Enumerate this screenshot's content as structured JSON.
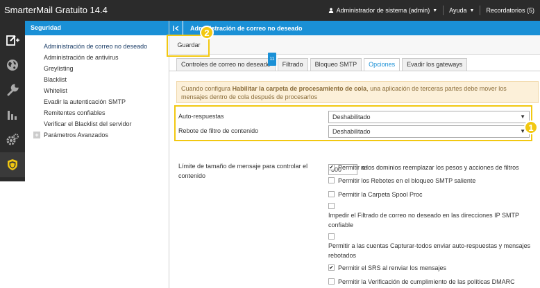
{
  "app": {
    "title": "SmarterMail Gratuito 14.4",
    "user_menu": "Administrador de sistema (admin)",
    "help_menu": "Ayuda",
    "reminders": "Recordatorios (5)"
  },
  "sidebar": {
    "header": "Seguridad",
    "items": [
      {
        "label": "Administración de correo no deseado",
        "selected": true
      },
      {
        "label": "Administración de antivirus"
      },
      {
        "label": "Greylisting"
      },
      {
        "label": "Blacklist"
      },
      {
        "label": "Whitelist"
      },
      {
        "label": "Evadir la autenticación SMTP"
      },
      {
        "label": "Remitentes confiables"
      },
      {
        "label": "Verificar el Blacklist del servidor"
      }
    ],
    "advanced": "Parámetros Avanzados",
    "expand_symbol": "+"
  },
  "main": {
    "title": "Administración de correo no deseado",
    "save_label": "Guardar",
    "callout_1": "1",
    "callout_2": "2",
    "tabs": [
      {
        "label": "Controles de correo no deseado",
        "badge": "11"
      },
      {
        "label": "Filtrado"
      },
      {
        "label": "Bloqueo SMTP"
      },
      {
        "label": "Opciones",
        "active": true
      },
      {
        "label": "Evadir los gateways"
      }
    ],
    "notice_before": "Cuando configura ",
    "notice_bold": "Habilitar la carpeta de procesamiento de cola",
    "notice_after": ", una aplicación de terceras partes debe mover los mensajes dentro de cola después de procesarlos",
    "auto_reply_label": "Auto-respuestas",
    "auto_reply_value": "Deshabilitado",
    "bounce_label": "Rebote de filtro de contenido",
    "bounce_value": "Deshabilitado",
    "limit_label": "Límite de tamaño de mensaje para controlar el contenido",
    "limit_value": "300",
    "limit_unit": "KB",
    "checks": [
      {
        "label": "Permitir a los dominios reemplazar los pesos y acciones de filtros",
        "checked": true
      },
      {
        "label": "Permitir los Rebotes en el bloqueo SMTP saliente",
        "checked": false
      },
      {
        "label": "Permitir la Carpeta Spool Proc",
        "checked": false
      },
      {
        "label": "Impedir el Filtrado de correo no deseado en las direcciones IP SMTP confiable",
        "checked": false
      },
      {
        "label": "Permitir a las cuentas Capturar-todos enviar auto-respuestas y mensajes rebotados",
        "checked": false
      },
      {
        "label": "Permitir el SRS al renviar los mensajes",
        "checked": true
      },
      {
        "label": "Permitir la Verificación de cumplimiento de las políticas DMARC",
        "checked": false
      }
    ]
  },
  "colors": {
    "header_blue": "#1a90d6",
    "dark_bar": "#2b2b2b",
    "highlight": "#f2c811",
    "notice_bg": "#fcf0d9"
  },
  "icons": [
    "compose-icon",
    "globe-icon",
    "wrench-icon",
    "chart-icon",
    "gear-icon",
    "shield-icon",
    "user-icon",
    "caret-down-icon",
    "collapse-icon"
  ]
}
